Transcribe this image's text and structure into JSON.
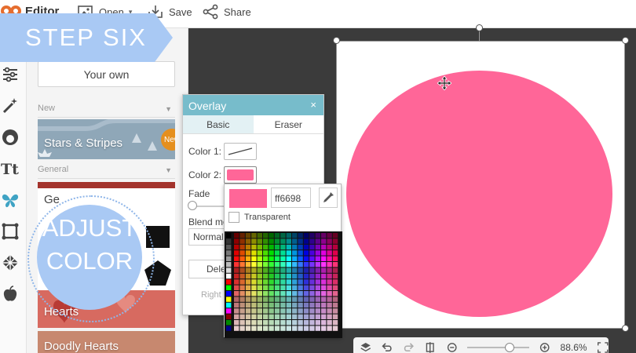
{
  "app": {
    "brand": "Editor"
  },
  "toolbar": {
    "open_label": "Open",
    "save_label": "Save",
    "share_label": "Share"
  },
  "tutorial": {
    "step_title": "STEP SIX",
    "callout_line1": "ADJUST",
    "callout_line2": "COLOR"
  },
  "panel": {
    "your_own_label": "Your own",
    "sections": [
      {
        "label": "New"
      },
      {
        "label": "General"
      }
    ],
    "cards": [
      {
        "label": "Stars & Stripes",
        "badge": "New"
      },
      {
        "label": "Ge"
      },
      {
        "label": "Hearts"
      },
      {
        "label": "Doodly Hearts"
      }
    ]
  },
  "rail": {
    "icons": [
      "adjustments-icon",
      "magic-wand-icon",
      "face-icon",
      "text-icon",
      "butterfly-icon",
      "frame-icon",
      "texture-icon",
      "apple-icon"
    ]
  },
  "overlay_dialog": {
    "title": "Overlay",
    "close": "×",
    "tabs": [
      {
        "label": "Basic",
        "active": true
      },
      {
        "label": "Eraser",
        "active": false
      }
    ],
    "color1_label": "Color 1:",
    "color2_label": "Color 2:",
    "color2_value": "#ff6698",
    "fade_label": "Fade",
    "blend_label": "Blend mo",
    "blend_value": "Normal",
    "delete_label": "Dele",
    "right_label": "Right"
  },
  "color_picker": {
    "hex_value": "ff6698",
    "transparent_label": "Transparent"
  },
  "canvas": {
    "shape_color": "#ff6698",
    "background_color": "#ffffff"
  },
  "bottom_toolbar": {
    "zoom_label": "88.6%"
  },
  "colors": {
    "accent_teal": "#77bccb",
    "badge_orange": "#e58f1e",
    "tutorial_blue": "#a9c9f4",
    "workspace_dark": "#3b3b3b"
  }
}
